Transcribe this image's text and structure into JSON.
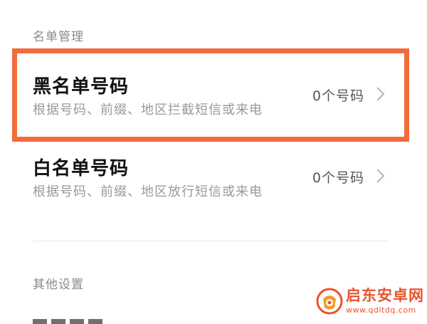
{
  "sections": {
    "list_management": "名单管理",
    "other_settings": "其他设置"
  },
  "blacklist": {
    "title": "黑名单号码",
    "description": "根据号码、前缀、地区拦截短信或来电",
    "count": "0个号码",
    "chevron_icon": "chevron-right-icon"
  },
  "whitelist": {
    "title": "白名单号码",
    "description": "根据号码、前缀、地区放行短信或来电",
    "count": "0个号码",
    "chevron_icon": "chevron-right-icon"
  },
  "highlight": {
    "color": "#f26b3a"
  },
  "watermark": {
    "name": "启东安卓网",
    "url": "www.qdltdq.com",
    "color": "#e8542b"
  }
}
